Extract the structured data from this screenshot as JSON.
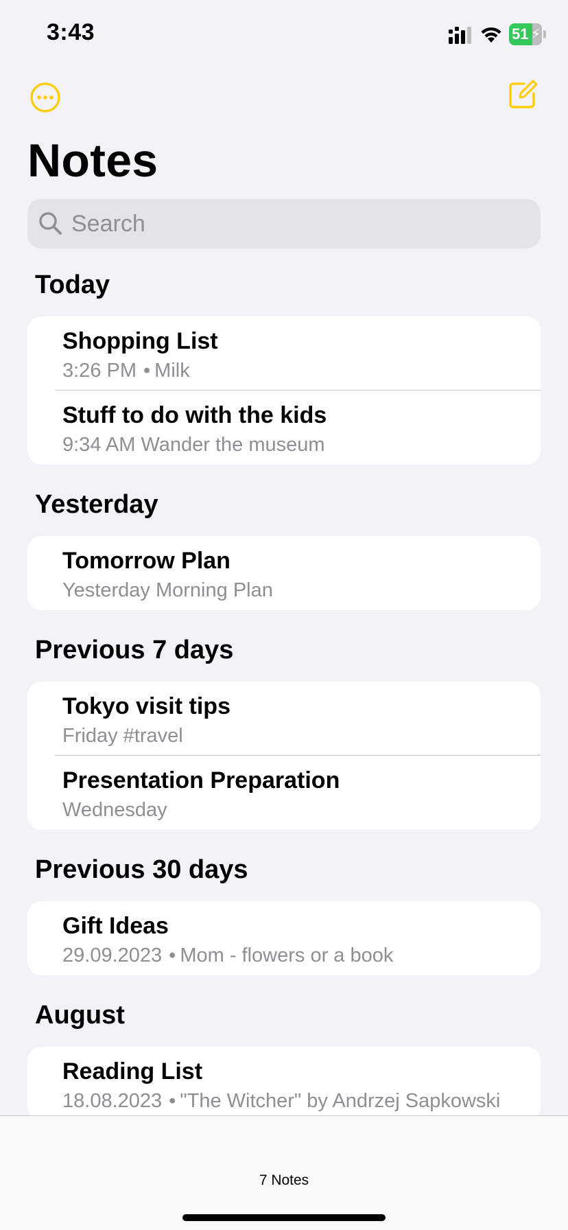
{
  "status_bar": {
    "time": "3:43",
    "battery": "51",
    "icons": [
      "signal-icon",
      "wifi-icon",
      "battery-icon"
    ]
  },
  "colors": {
    "accent": "#FFCC00",
    "background": "#F2F2F7",
    "secondary_text": "#8E8E93",
    "battery_green": "#34C759"
  },
  "nav": {
    "more_icon": "ellipsis-circle-icon",
    "compose_icon": "compose-icon",
    "title": "Notes"
  },
  "search": {
    "placeholder": "Search",
    "value": ""
  },
  "sections": [
    {
      "header": "Today",
      "notes": [
        {
          "title": "Shopping List",
          "date": "3:26 PM",
          "preview": "Milk"
        },
        {
          "title": "Stuff to do with the kids",
          "date": "9:34 AM",
          "preview": "Wander the museum"
        }
      ]
    },
    {
      "header": "Yesterday",
      "notes": [
        {
          "title": "Tomorrow Plan",
          "date": "Yesterday",
          "preview": "Morning Plan"
        }
      ]
    },
    {
      "header": "Previous 7 days",
      "notes": [
        {
          "title": "Tokyo visit tips",
          "date": "Friday",
          "preview": "#travel"
        },
        {
          "title": "Presentation Preparation",
          "date": "Wednesday",
          "preview": ""
        }
      ]
    },
    {
      "header": "Previous 30 days",
      "notes": [
        {
          "title": "Gift Ideas",
          "date": "29.09.2023",
          "preview": "Mom - flowers or a book"
        }
      ]
    },
    {
      "header": "August",
      "notes": [
        {
          "title": "Reading List",
          "date": "18.08.2023",
          "preview": "\"The Witcher\" by Andrzej Sapkowski"
        }
      ]
    }
  ],
  "footer": {
    "note_count": "7 Notes"
  }
}
